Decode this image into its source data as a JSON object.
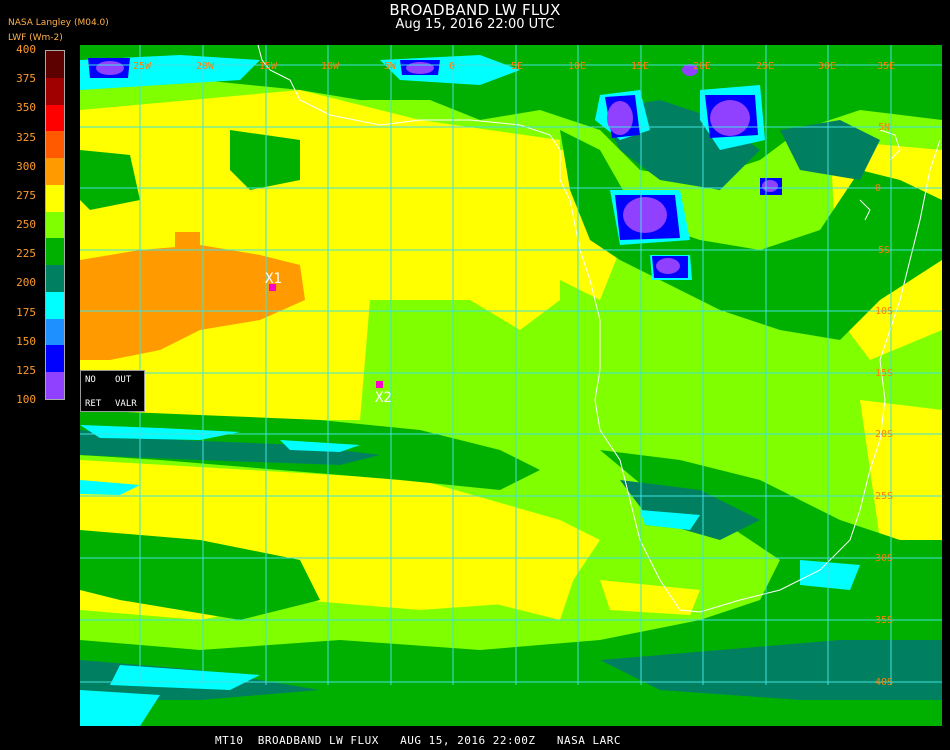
{
  "header": {
    "title": "BROADBAND LW FLUX",
    "datetime": "Aug 15, 2016 22:00 UTC",
    "source": "NASA Langley (M04.0)",
    "units": "LWF (Wm-2)"
  },
  "colorbar": {
    "ticks": [
      "400",
      "375",
      "350",
      "325",
      "300",
      "275",
      "250",
      "225",
      "200",
      "175",
      "150",
      "125",
      "100"
    ],
    "colors": [
      "#5c0000",
      "#a00000",
      "#ff0000",
      "#ff5a00",
      "#ff9b00",
      "#ffff00",
      "#80ff00",
      "#00b000",
      "#008060",
      "#00ffff",
      "#1e90ff",
      "#0000ff",
      "#9040ff"
    ]
  },
  "map": {
    "lon_labels": [
      "25W",
      "20W",
      "15W",
      "10W",
      "5W",
      "0",
      "5E",
      "10E",
      "15E",
      "20E",
      "25E",
      "30E",
      "35E"
    ],
    "lat_labels": [
      "5N",
      "0",
      "5S",
      "10S",
      "15S",
      "20S",
      "25S",
      "30S",
      "35S",
      "40S"
    ],
    "markers": [
      {
        "label": "X1",
        "color": "#ff00c8"
      },
      {
        "label": "X2",
        "color": "#ff00c8"
      }
    ],
    "grid_color": "#40e0e0",
    "coast_color": "#ffffff"
  },
  "legend": {
    "no_ret": [
      "NO",
      "RET"
    ],
    "out_valr": [
      "OUT",
      "VALR"
    ]
  },
  "footer": "MT10  BROADBAND LW FLUX   AUG 15, 2016 22:00Z   NASA LARC"
}
